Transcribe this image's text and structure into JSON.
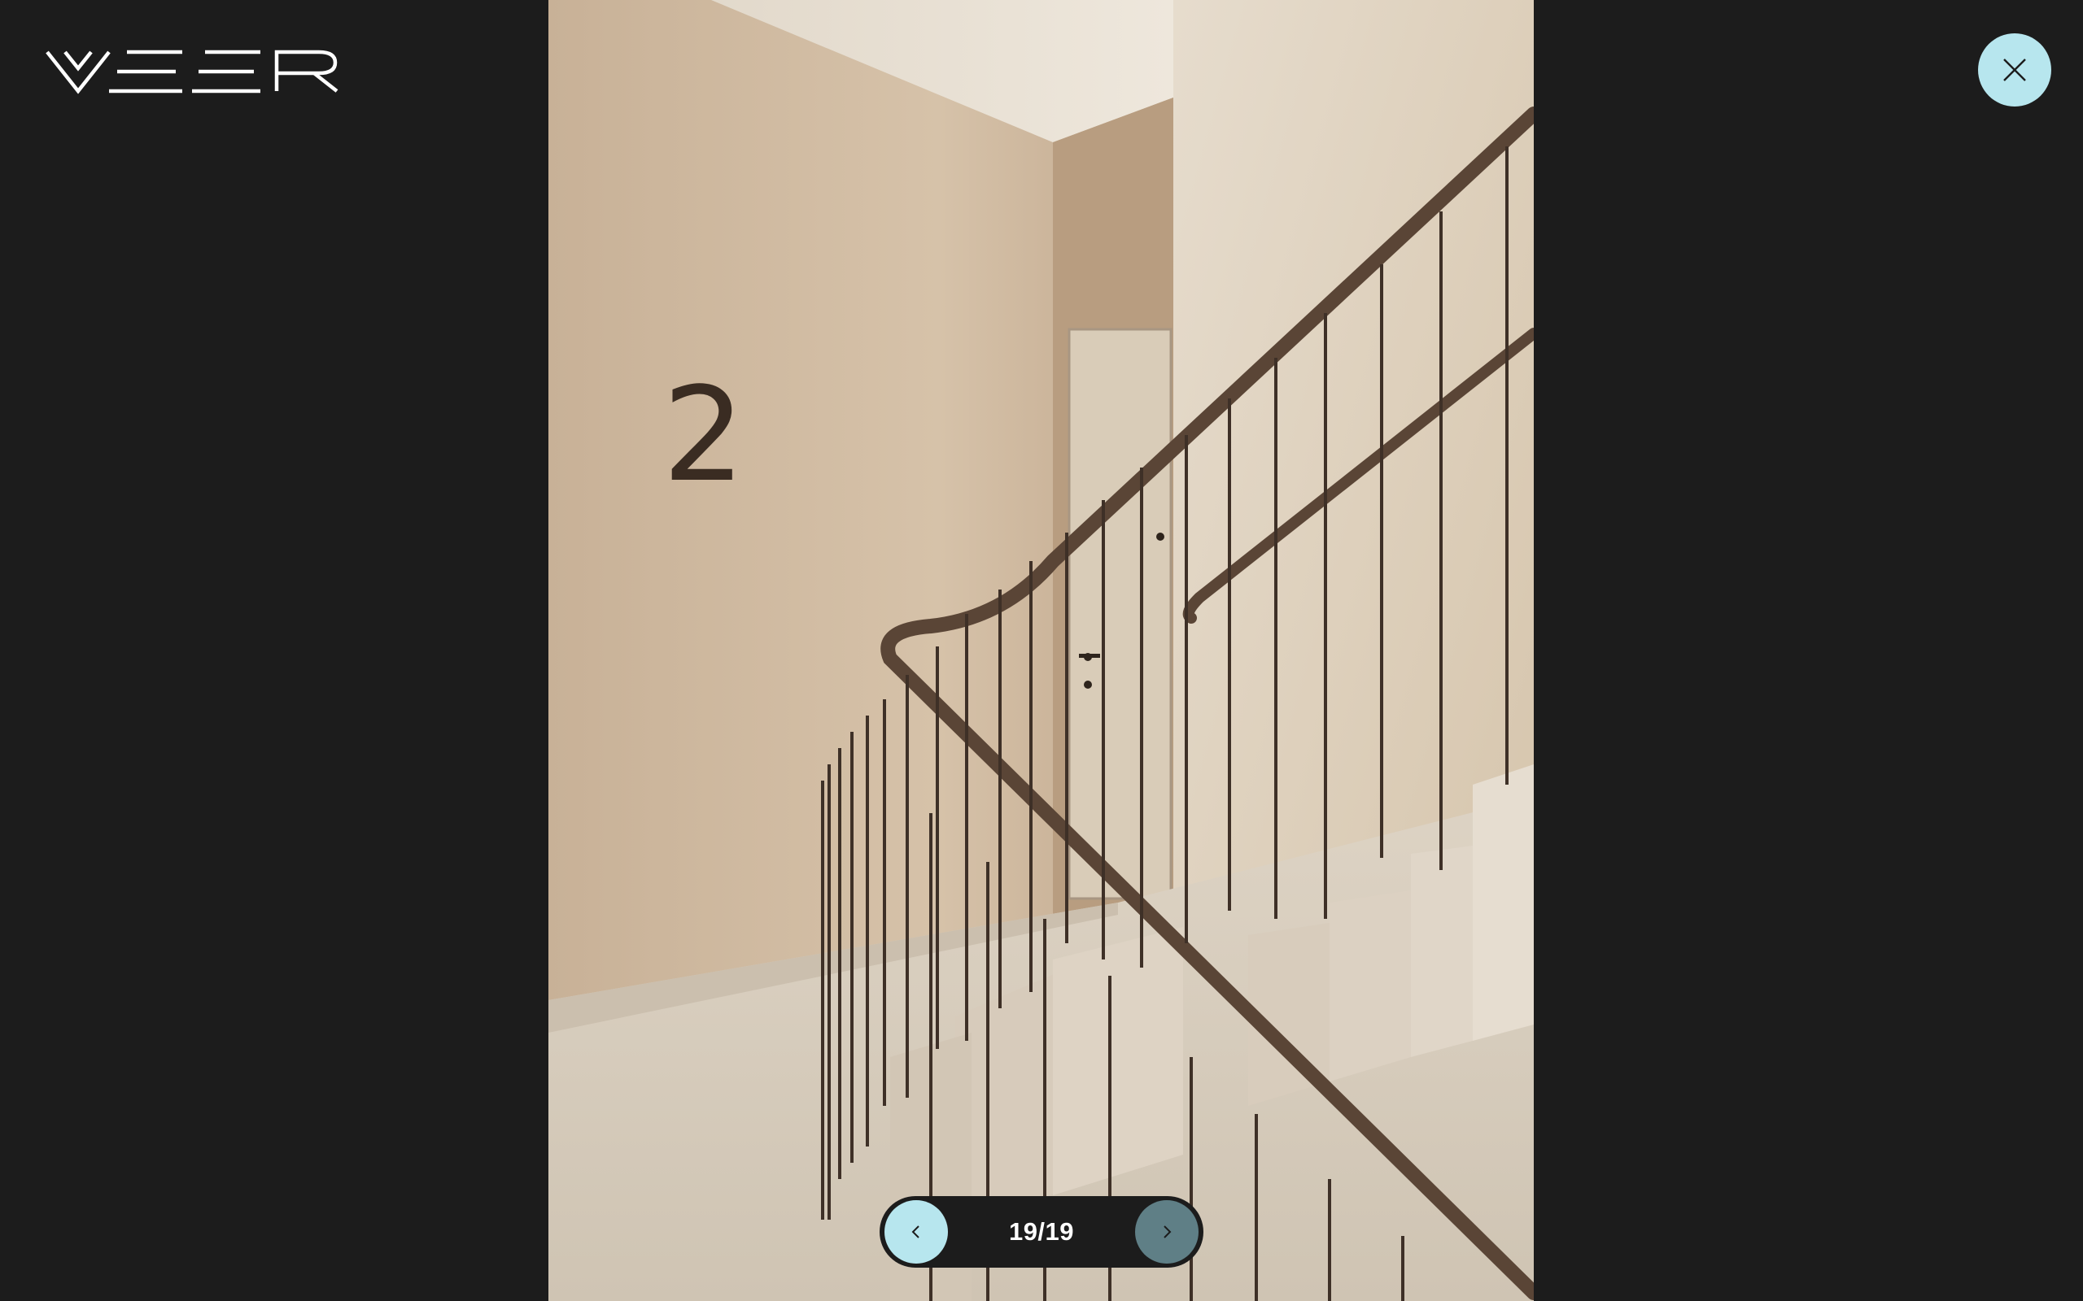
{
  "brand": {
    "logo_text": "VEER",
    "logo_color": "#ffffff"
  },
  "lightbox": {
    "close_icon": "close-icon",
    "close_color": "#b7e6ee",
    "image_content": "2",
    "pager": {
      "counter": "19/19",
      "prev_icon": "chevron-left-icon",
      "next_icon": "chevron-right-icon",
      "prev_color": "#b7e6ee",
      "next_color": "#5f7f86"
    }
  },
  "colors": {
    "background": "#1c1c1c",
    "accent": "#b7e6ee"
  }
}
